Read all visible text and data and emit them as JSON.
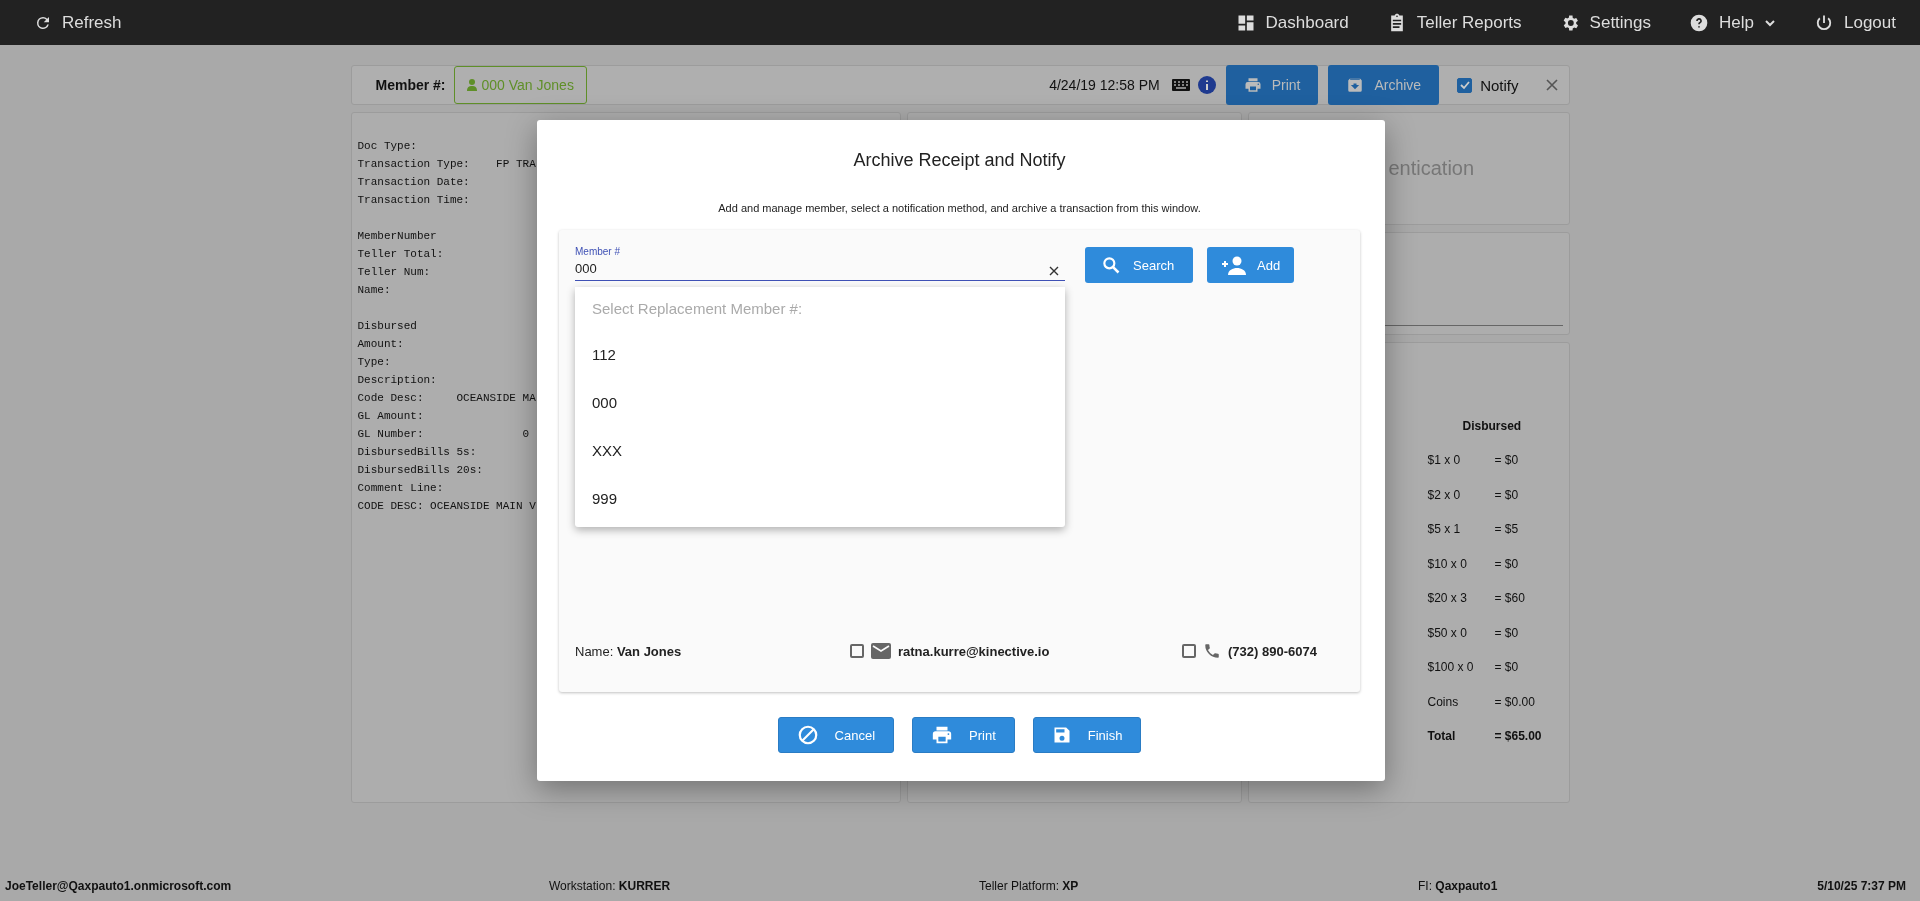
{
  "top_bar": {
    "left": [
      {
        "label": "Refresh"
      }
    ],
    "right": [
      {
        "label": "Dashboard",
        "has_menu": false
      },
      {
        "label": "Teller Reports",
        "has_menu": false
      },
      {
        "label": "Settings",
        "has_menu": false
      },
      {
        "label": "Help",
        "has_menu": true
      },
      {
        "label": "Logout",
        "has_menu": false
      }
    ]
  },
  "header": {
    "member_label": "Member #:",
    "member_chip": "000 Van Jones",
    "datetime": "4/24/19 12:58 PM",
    "buttons": [
      "Print",
      "Archive"
    ],
    "notify": {
      "label": "Notify",
      "checked": true
    }
  },
  "receipt_groups": [
    [
      "Doc Type:",
      "Transaction Type:    FP TRA",
      "Transaction Date:",
      "Transaction Time:"
    ],
    [
      "MemberNumber",
      "Teller Total:",
      "Teller Num:",
      "Name:"
    ],
    [
      "Disbursed",
      "Amount:",
      "Type:",
      "Description:",
      "Code Desc:     OCEANSIDE MA",
      "GL Amount:",
      "GL Number:               0",
      "DisbursedBills 5s:",
      "DisbursedBills 20s:",
      "Comment Line:",
      "CODE DESC: OCEANSIDE MAIN V"
    ]
  ],
  "auth_panel": {
    "title": "entication"
  },
  "denominations": {
    "heading": "Disbursed",
    "rows": [
      {
        "kind": "line",
        "item": "$1 x 0",
        "amount": "= $0"
      },
      {
        "kind": "line",
        "item": "$2 x 0",
        "amount": "= $0"
      },
      {
        "kind": "line",
        "item": "$5 x 1",
        "amount": "= $5"
      },
      {
        "kind": "line",
        "item": "$10 x 0",
        "amount": "= $0"
      },
      {
        "kind": "line",
        "item": "$20 x 3",
        "amount": "= $60"
      },
      {
        "kind": "line",
        "item": "$50 x 0",
        "amount": "= $0"
      },
      {
        "kind": "line",
        "item": "$100 x 0",
        "amount": "= $0"
      },
      {
        "kind": "line",
        "item": "Coins",
        "amount": "= $0.00"
      },
      {
        "kind": "total",
        "item": "Total",
        "amount": "= $65.00"
      }
    ]
  },
  "modal": {
    "title": "Archive Receipt and Notify",
    "subtitle": "Add and manage member, select a notification method, and archive a transaction from this window.",
    "member_field": {
      "label": "Member #",
      "value": "000"
    },
    "buttons": [
      "Search",
      "Add"
    ],
    "dropdown": {
      "placeholder": "Select Replacement Member #:",
      "options": [
        {
          "label": "112",
          "selected": false
        },
        {
          "label": "000",
          "selected": false
        },
        {
          "label": "XXX",
          "selected": false
        },
        {
          "label": "999",
          "selected": false
        }
      ]
    },
    "name": "Name: **Van Jones**",
    "email": {
      "value": "ratna.kurre@kinective.io",
      "checked": false
    },
    "phone": {
      "value": "(732) 890-6074",
      "checked": false
    },
    "actions": [
      "Cancel",
      "Print",
      "Finish"
    ]
  },
  "status_bar": [
    {
      "kind": "strong",
      "text": "JoeTeller@Qaxpauto1.onmicrosoft.com"
    },
    {
      "kind": "field",
      "text": "Workstation: **KURRER**"
    },
    {
      "kind": "field",
      "text": "Teller Platform: **XP**"
    },
    {
      "kind": "field",
      "text": "FI: **Qaxpauto1**"
    },
    {
      "kind": "strong",
      "text": "5/10/25 7:37 PM"
    }
  ]
}
